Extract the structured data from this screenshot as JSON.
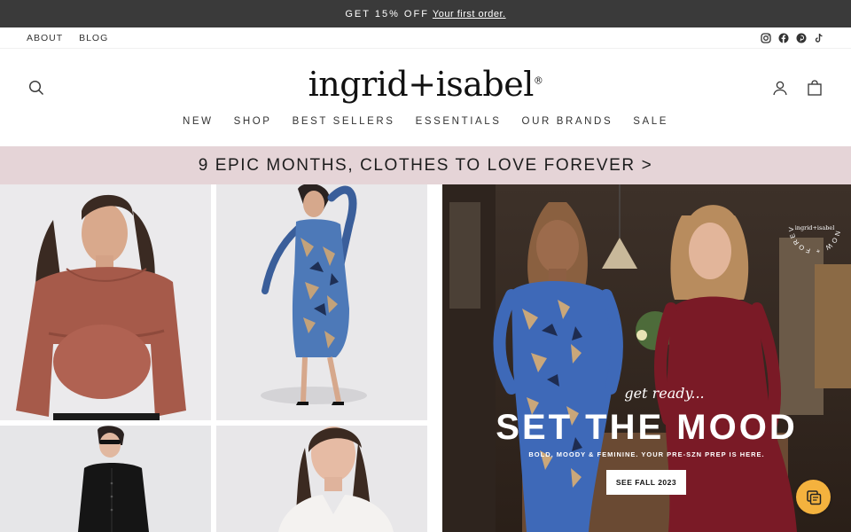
{
  "promo": {
    "prefix": "GET 15% OFF",
    "link": "Your first order."
  },
  "utility": {
    "links": [
      "ABOUT",
      "BLOG"
    ]
  },
  "social": [
    "instagram-icon",
    "facebook-icon",
    "pinterest-icon",
    "tiktok-icon"
  ],
  "header": {
    "logo": "ingrid+isabel",
    "logo_mark": "®"
  },
  "nav": [
    "NEW",
    "SHOP",
    "BEST SELLERS",
    "ESSENTIALS",
    "OUR BRANDS",
    "SALE"
  ],
  "banner": "9 EPIC MONTHS, CLOTHES TO LOVE FOREVER >",
  "hero": {
    "kicker": "get ready...",
    "headline": "SET THE MOOD",
    "subhead": "BOLD, MOODY & FEMININE. YOUR PRE-SZN PREP IS HERE.",
    "cta": "SEE FALL 2023",
    "stamp_ring": "NOW + FOREVER",
    "stamp_center": "ingrid+isabel"
  },
  "colors": {
    "promo_bg": "#3a3a3a",
    "banner_bg": "#e5d4d7",
    "chat_bg": "#f4b23e"
  }
}
